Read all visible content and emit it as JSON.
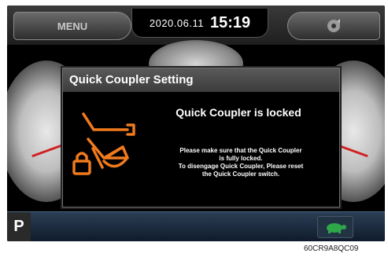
{
  "header": {
    "menu_label": "MENU",
    "date": "2020.06.11",
    "time": "15:19",
    "right_button_icon": "audio-icon"
  },
  "dialog": {
    "title": "Quick Coupler Setting",
    "status": "Quick Coupler is locked",
    "detail_lines": [
      "Please make sure that the Quick Coupler",
      "is fully locked.",
      "To disengage Quick Coupler, Please reset",
      "the Quick Coupler switch."
    ],
    "icon": "quick-coupler-lock-icon",
    "icon_color": "#f07a1e"
  },
  "footer": {
    "gear": "P",
    "mode_icon": "turtle-icon",
    "mode_color": "#2fa84a"
  },
  "caption": "60CR9A8QC09"
}
